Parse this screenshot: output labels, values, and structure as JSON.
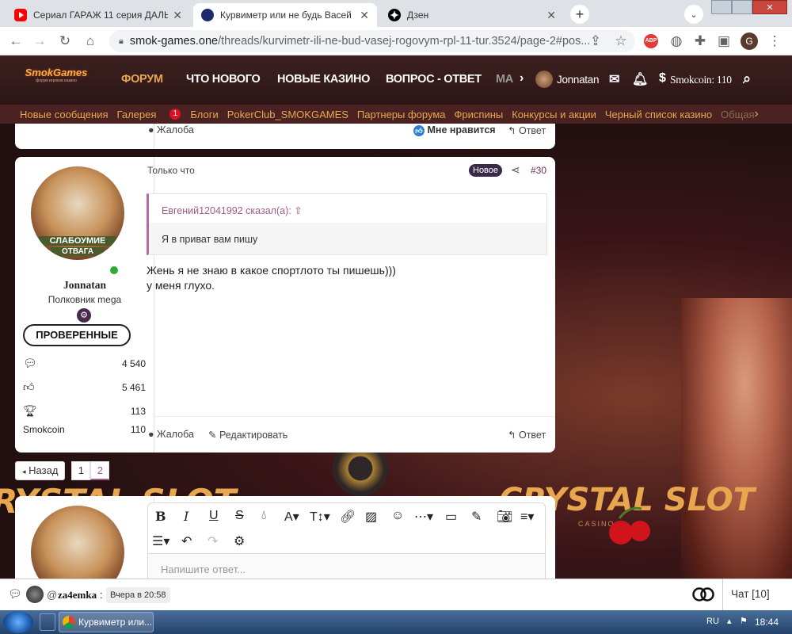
{
  "browser": {
    "tabs": [
      {
        "title": "Сериал ГАРАЖ 11 серия ДАЛЬНЕ",
        "favicon": "youtube-icon",
        "color": "#ff0000"
      },
      {
        "title": "Курвиметр или не будь Васей Р",
        "favicon": "smok-icon",
        "color": "#1e2a6e"
      },
      {
        "title": "Дзен",
        "favicon": "dzen-icon",
        "color": "#000000"
      }
    ],
    "url_domain": "smok-games.one",
    "url_path": "/threads/kurvimetr-ili-ne-bud-vasej-rogovym-rpl-11-tur.3524/page-2#pos...",
    "profile_initial": "G"
  },
  "site": {
    "logo": "SmokGames",
    "logo_tagline": "форум игроков казино",
    "nav": [
      "ФОРУМ",
      "ЧТО НОВОГО",
      "НОВЫЕ КАЗИНО",
      "ВОПРОС - ОТВЕТ",
      "МА"
    ],
    "active_nav": "ФОРУМ",
    "username": "Jonnatan",
    "smokcoin": "Smokcoin: 110",
    "subnav": [
      "Новые сообщения",
      "Галерея",
      "Блоги",
      "PokerClub_SMOKGAMES",
      "Партнеры форума",
      "Фриспины",
      "Конкурсы и акции",
      "Черный список казино",
      "Общая"
    ],
    "gallery_badge": "1",
    "accent": "#e8a74f"
  },
  "prev_post": {
    "report": "Жалоба",
    "like": "Мне нравится",
    "reply": "Ответ"
  },
  "post": {
    "time": "Только что",
    "new_badge": "Новое",
    "number": "#30",
    "quote_author": "Евгений12041992 сказал(а):",
    "quote_text": "Я в приват вам пишу",
    "body_line1": "Жень я не знаю в какое спортлото ты пишешь)))",
    "body_line2": "у меня глухо.",
    "user": {
      "name": "Jonnatan",
      "avatar_caption_1": "СЛАБОУМИЕ",
      "avatar_caption_2": "ОТВАГА",
      "title": "Полковник mega",
      "banner": "ПРОВЕРЕННЫЕ",
      "messages": "4 540",
      "reactions": "5 461",
      "trophies": "113",
      "smokcoin_label": "Smokcoin",
      "smokcoin_value": "110"
    },
    "report": "Жалоба",
    "edit": "Редактировать",
    "reply": "Ответ"
  },
  "pagination": {
    "back": "Назад",
    "pages": [
      "1",
      "2"
    ],
    "current": "2"
  },
  "background_ad": {
    "brand_left": "RYSTAL SLOT",
    "brand_right": "CRYSTAL SLOT",
    "tagline": "CASINO"
  },
  "editor": {
    "placeholder": "Напишите ответ...",
    "tools": [
      "bold-icon",
      "italic-icon",
      "underline-icon",
      "strikethrough-icon",
      "color-icon",
      "font-family-icon",
      "font-size-icon",
      "link-icon",
      "image-icon",
      "emoji-icon",
      "more-icon",
      "media-icon",
      "draft-icon",
      "camera-icon",
      "align-icon",
      "list-icon",
      "undo-icon",
      "redo-icon",
      "settings-icon"
    ]
  },
  "chat": {
    "user": "za4emka",
    "time": "Вчера в 20:58",
    "chat_label": "Чат [10]"
  },
  "taskbar": {
    "window_title": "Курвиметр или...",
    "lang": "RU",
    "time": "18:44"
  }
}
